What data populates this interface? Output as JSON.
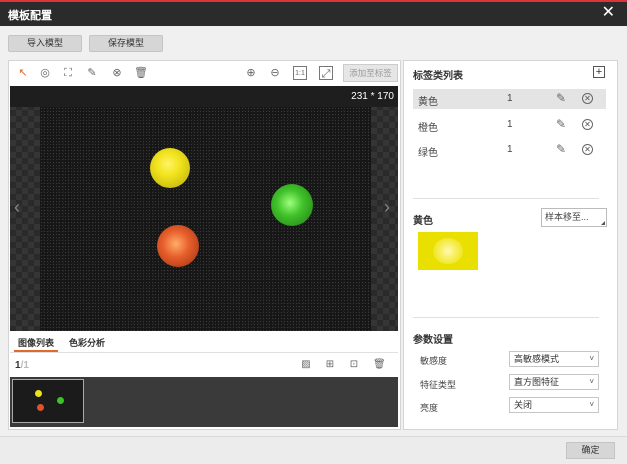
{
  "window": {
    "title": "模板配置",
    "close_glyph": "✕"
  },
  "toolbar_top": {
    "import_label": "导入模型",
    "save_label": "保存模型"
  },
  "canvas_toolbar": {
    "tools": [
      {
        "name": "pointer-icon",
        "glyph": "↖"
      },
      {
        "name": "circle-select-icon",
        "glyph": "◎"
      },
      {
        "name": "rect-select-icon",
        "glyph": "⛶"
      },
      {
        "name": "pen-icon",
        "glyph": "✎"
      },
      {
        "name": "cancel-icon",
        "glyph": "⊗"
      },
      {
        "name": "trash-icon",
        "glyph": "🗑"
      }
    ],
    "zoom": [
      {
        "name": "zoom-in-icon",
        "glyph": "⊕"
      },
      {
        "name": "zoom-out-icon",
        "glyph": "⊖"
      },
      {
        "name": "actual-size-icon",
        "glyph": "1:1"
      },
      {
        "name": "fit-window-icon",
        "glyph": "⤢"
      }
    ],
    "add_to_label": "添加至标签"
  },
  "canvas": {
    "dimensions": "231 * 170",
    "prev_glyph": "‹",
    "next_glyph": "›"
  },
  "image_tabs": {
    "list_label": "图像列表",
    "color_analysis_label": "色彩分析"
  },
  "pager": {
    "current": "1",
    "separator": "/",
    "total": "1"
  },
  "strip_icons": [
    {
      "name": "import-image-icon",
      "glyph": "▨"
    },
    {
      "name": "add-icon",
      "glyph": "⊞"
    },
    {
      "name": "folder-add-icon",
      "glyph": "⊡"
    },
    {
      "name": "trash-icon",
      "glyph": "🗑"
    }
  ],
  "label_list": {
    "title": "标签类列表",
    "add_glyph": "+",
    "items": [
      {
        "name": "黄色",
        "count": "1"
      },
      {
        "name": "橙色",
        "count": "1"
      },
      {
        "name": "绿色",
        "count": "1"
      }
    ]
  },
  "selected_label": {
    "name": "黄色",
    "move_label": "样本移至..."
  },
  "params": {
    "title": "参数设置",
    "rows": [
      {
        "label": "敏感度",
        "value": "高敏感模式"
      },
      {
        "label": "特征类型",
        "value": "直方图特征"
      },
      {
        "label": "亮度",
        "value": "关闭"
      }
    ]
  },
  "footer": {
    "ok_label": "确定"
  },
  "colors": {
    "accent": "#e06a2c",
    "title_bar": "#2b2b2b",
    "title_border": "#e0323a",
    "yellow": "#e9e000",
    "orange": "#e0522a",
    "green": "#3ec12a"
  }
}
